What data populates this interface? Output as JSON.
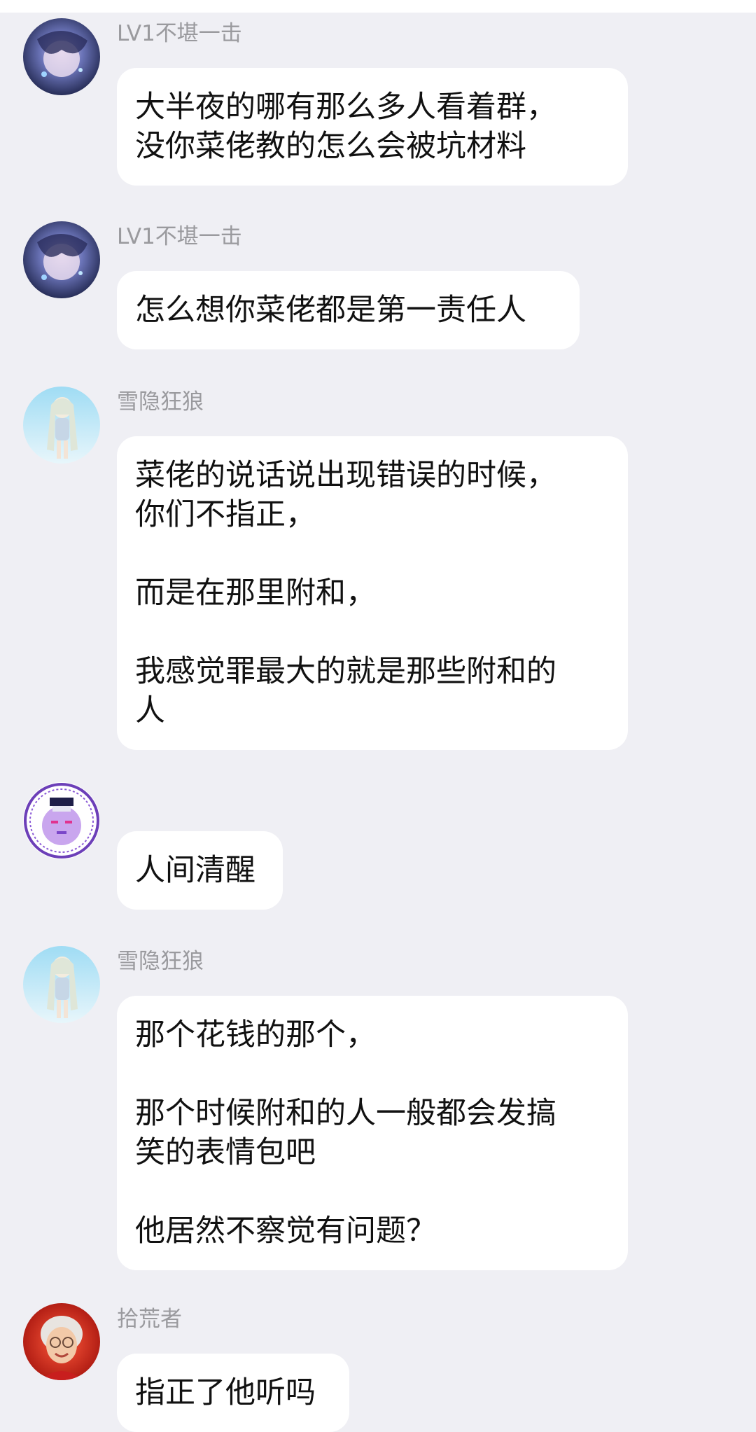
{
  "messages": [
    {
      "sender": "LV1不堪一击",
      "avatar": "galaxy-girl-avatar",
      "lines": [
        "大半夜的哪有那么多人看着群，",
        "没你菜佬教的怎么会被坑材料"
      ]
    },
    {
      "sender": "LV1不堪一击",
      "avatar": "galaxy-girl-avatar",
      "lines": [
        "怎么想你菜佬都是第一责任人"
      ]
    },
    {
      "sender": "雪隐狂狼",
      "avatar": "anime-girl-avatar",
      "lines": [
        "菜佬的说话说出现错误的时候，",
        "你们不指正，",
        "",
        "而是在那里附和，",
        "",
        "我感觉罪最大的就是那些附和的",
        "人"
      ]
    },
    {
      "sender": "",
      "avatar": "pixel-badge-avatar",
      "lines": [
        "人间清醒"
      ]
    },
    {
      "sender": "雪隐狂狼",
      "avatar": "anime-girl-avatar",
      "lines": [
        "那个花钱的那个，",
        "",
        "那个时候附和的人一般都会发搞",
        "笑的表情包吧",
        "",
        "他居然不察觉有问题？"
      ]
    },
    {
      "sender": "拾荒者",
      "avatar": "grandma-avatar",
      "lines": [
        "指正了他听吗"
      ]
    }
  ],
  "colors": {
    "background": "#efeff4",
    "bubble": "#ffffff",
    "sender_name": "#9a9a9e",
    "message_text": "#111111"
  }
}
